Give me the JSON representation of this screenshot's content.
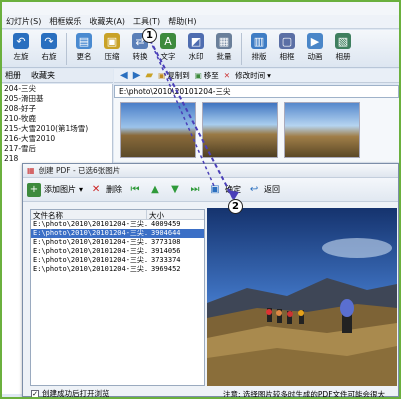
{
  "menu": [
    "幻灯片(S)",
    "相框娱乐",
    "收藏夹(A)",
    "工具(T)",
    "帮助(H)"
  ],
  "toolbar": [
    {
      "label": "左旋",
      "icon": "rotate-left-icon",
      "color": "#2a6fbf",
      "glyph": "↶"
    },
    {
      "label": "右旋",
      "icon": "rotate-right-icon",
      "color": "#2a6fbf",
      "glyph": "↷"
    },
    {
      "label": "更名",
      "icon": "rename-icon",
      "color": "#4a8ad0",
      "glyph": "▤"
    },
    {
      "label": "压缩",
      "icon": "compress-icon",
      "color": "#c9a227",
      "glyph": "▣"
    },
    {
      "label": "转换",
      "icon": "convert-icon",
      "color": "#5a7fb8",
      "glyph": "⇄"
    },
    {
      "label": "文字",
      "icon": "text-icon",
      "color": "#3d8a3d",
      "glyph": "A"
    },
    {
      "label": "水印",
      "icon": "watermark-icon",
      "color": "#4f6db0",
      "glyph": "◩"
    },
    {
      "label": "批量",
      "icon": "batch-icon",
      "color": "#6a7f9a",
      "glyph": "▦"
    },
    {
      "label": "排版",
      "icon": "layout-icon",
      "color": "#3e7cc4",
      "glyph": "▥"
    },
    {
      "label": "相框",
      "icon": "frame-icon",
      "color": "#5b6fa5",
      "glyph": "▢"
    },
    {
      "label": "动画",
      "icon": "animation-icon",
      "color": "#4a86c8",
      "glyph": "▶"
    },
    {
      "label": "相册",
      "icon": "album-icon",
      "color": "#3f7f5f",
      "glyph": "▧"
    }
  ],
  "sidebar": {
    "tabs": [
      "相册",
      "收藏夹"
    ],
    "items": [
      "204-三尖",
      "205-滑田基",
      "208-好子",
      "210-牧鹿",
      "215-大雪2010(第1场雪)",
      "216-大雪2010",
      "217-雪后",
      "218"
    ]
  },
  "nav": {
    "copy_to": "复制到",
    "move_to": "移至",
    "sort": "修改时间"
  },
  "path": "E:\\photo\\2010\\20101204-三尖",
  "dialog": {
    "title": "创建 PDF - 已选6张图片",
    "add": "添加图片",
    "delete": "删除",
    "ok": "确定",
    "back": "返回",
    "col_name": "文件名称",
    "col_size": "大小",
    "rows": [
      {
        "name": "E:\\photo\\2010\\20101204-三尖...",
        "size": "4009459",
        "selected": false
      },
      {
        "name": "E:\\photo\\2010\\20101204-三尖...",
        "size": "3904644",
        "selected": true
      },
      {
        "name": "E:\\photo\\2010\\20101204-三尖...",
        "size": "3773108",
        "selected": false
      },
      {
        "name": "E:\\photo\\2010\\20101204-三尖...",
        "size": "3914056",
        "selected": false
      },
      {
        "name": "E:\\photo\\2010\\20101204-三尖...",
        "size": "3733374",
        "selected": false
      },
      {
        "name": "E:\\photo\\2010\\20101204-三尖...",
        "size": "3969452",
        "selected": false
      }
    ],
    "checkbox": "创建成功后打开浏览",
    "note": "注意: 选择图片较多时生成的PDF文件可能会很大"
  },
  "callouts": [
    "1",
    "2"
  ],
  "accent": "#3b6fc6"
}
